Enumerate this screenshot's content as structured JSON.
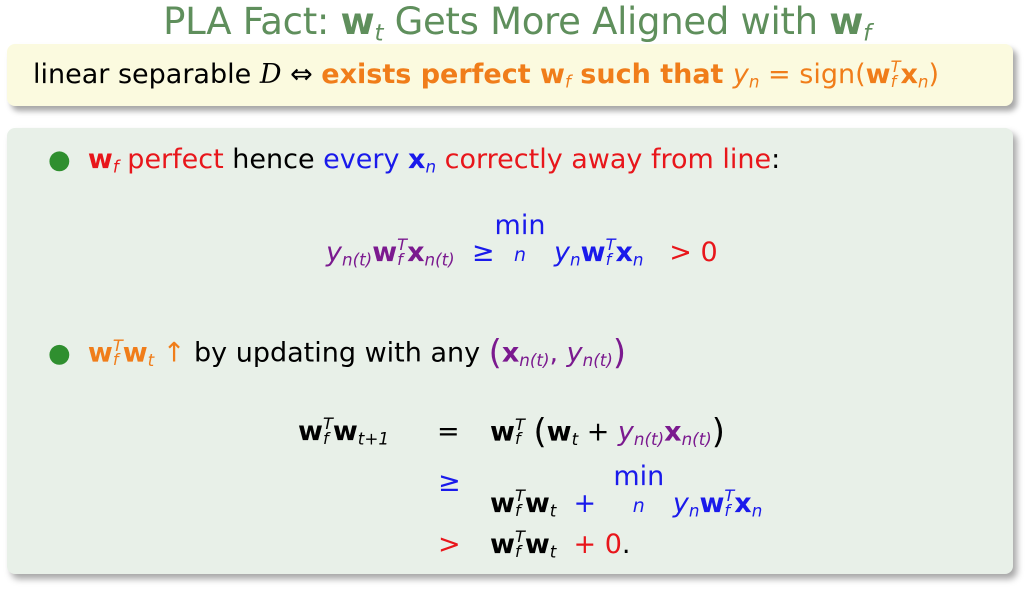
{
  "title": {
    "prefix": "PLA Fact: ",
    "w": "w",
    "t": "t",
    "middle": " Gets More Aligned with ",
    "w2": "w",
    "f": "f"
  },
  "box": {
    "text1": "linear separable ",
    "calD": "D",
    "iff": " ⇔ ",
    "exists": "exists perfect ",
    "w": "w",
    "f": "f",
    "such": " such that ",
    "y": "y",
    "n": "n",
    "eq": " = sign(",
    "T": "T",
    "x": "x",
    "close": ")"
  },
  "bullet1": {
    "w": "w",
    "f": "f",
    "perfect": " perfect",
    "hence": " hence ",
    "every": "every ",
    "x": "x",
    "n": "n",
    "away": " correctly away from line",
    "colon": ":"
  },
  "eq1": {
    "y": "y",
    "nt": "n(t)",
    "w": "w",
    "T": "T",
    "f": "f",
    "x": "x",
    "ge": "≥",
    "min": "min",
    "n": "n",
    "gt": ">",
    "zero": "0"
  },
  "bullet2": {
    "w": "w",
    "T": "T",
    "f": "f",
    "t": "t",
    "up": " ↑",
    "text": " by updating with any ",
    "lp": "(",
    "x": "x",
    "nt": "n(t)",
    "comma": ", ",
    "y": "y",
    "rp": ")"
  },
  "eq2": {
    "row1": {
      "lhs_t1": "t+1",
      "eq": "=",
      "plus": " + ",
      "lp": "(",
      "rp": ")"
    },
    "row2": {
      "ge": "≥",
      "plus": "+",
      "min": "min"
    },
    "row3": {
      "gt": ">",
      "plus": "+ 0",
      "dot": "."
    }
  },
  "colors": {
    "title": "#5f8f5c",
    "orange": "#f07d1a",
    "red": "#e8161b",
    "blue": "#1a1aeb",
    "purple": "#7b1a8f",
    "green_box": "#e8f0e8",
    "yellow_box": "#fbfadf"
  }
}
